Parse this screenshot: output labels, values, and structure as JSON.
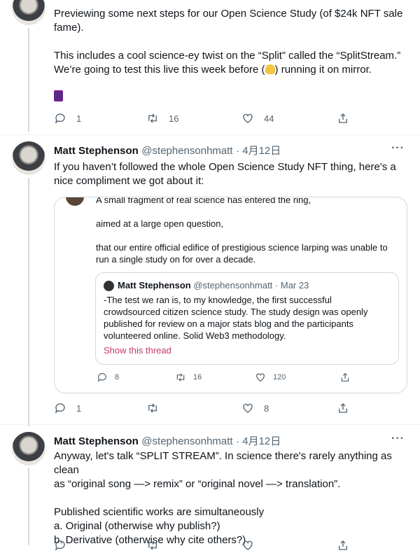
{
  "tweet1": {
    "text_line1": "Previewing some next steps for our Open Science Study (of $24k NFT sale",
    "text_line2": "fame).",
    "text_line3": "This includes a cool science-ey twist on the “Split” called the “SplitStream.”",
    "text_line4_a": "We’re going to test this live this week before (",
    "text_line4_b": ") running it on mirror.",
    "actions": {
      "replies": "1",
      "retweets": "16",
      "likes": "44"
    }
  },
  "tweet2": {
    "name": "Matt Stephenson",
    "handle": "@stephensonhmatt",
    "date": "· 4月12日",
    "more": "···",
    "text_line1": "If you haven’t followed the whole Open Science Study NFT thing, here's a",
    "text_line2": "nice compliment we got about it:",
    "quote": {
      "line1": "A small fragment of real science has entered the ring,",
      "line2": "aimed at a large open question,",
      "line3": "that our entire official edifice of prestigious science larping was unable to",
      "line4": "run a single study on for over a decade.",
      "inner": {
        "name": "Matt Stephenson",
        "handle": "@stephensonhmatt",
        "date": "· Mar 23",
        "line1": "-The test we ran is, to my knowledge, the first successful",
        "line2": "crowdsourced citizen science study.  The study design was openly",
        "line3": "published for review on a major stats blog and the participants",
        "line4": "volunteered online.  Solid Web3 methodology.",
        "show_thread": "Show this thread"
      },
      "actions": {
        "replies": "8",
        "retweets": "16",
        "likes": "120"
      }
    },
    "actions": {
      "replies": "1",
      "retweets": "",
      "likes": "8"
    }
  },
  "tweet3": {
    "name": "Matt Stephenson",
    "handle": "@stephensonhmatt",
    "date": "· 4月12日",
    "more": "···",
    "text_line1": "Anyway, let's talk “SPLIT STREAM”. In science there's rarely anything as clean",
    "text_line2": "as “original song —> remix” or “original novel —> translation”.",
    "text_line3": "Published scientific works are simultaneously",
    "text_line4": "a. Original (otherwise why publish?)",
    "text_line5": "b. Derivative (otherwise why cite others?)"
  },
  "colors": {
    "accent": "#1d9bf0",
    "muted": "#536471",
    "show_thread": "#c23c70",
    "border": "#cfd9de"
  }
}
